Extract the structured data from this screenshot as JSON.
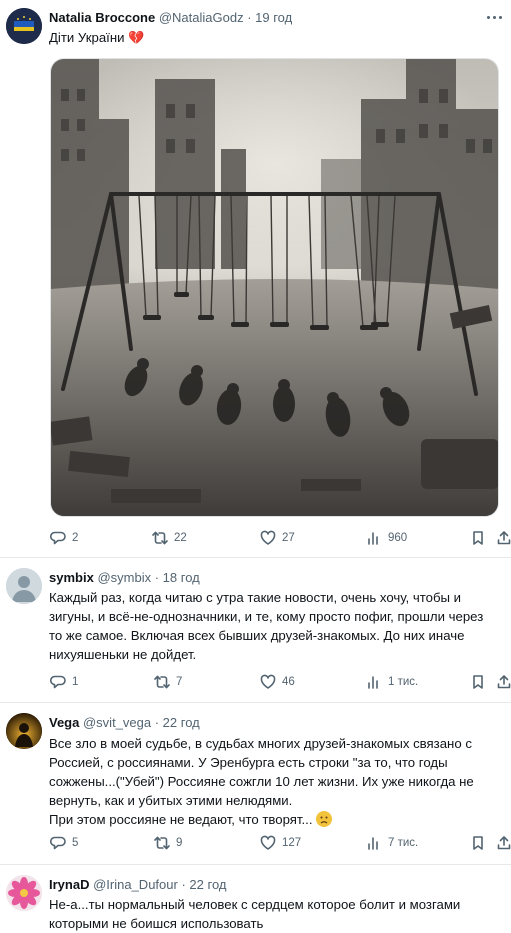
{
  "tweets": [
    {
      "name": "Natalia Broccone",
      "handle": "@NataliaGodz",
      "time": "· 19 год",
      "text_lines": [
        "Діти України"
      ],
      "heart": "💔",
      "stats": {
        "replies": "2",
        "retweets": "22",
        "likes": "27",
        "views": "960"
      }
    },
    {
      "name": "symbix",
      "handle": "@symbix",
      "time": "· 18 год",
      "text_lines": [
        "Каждый раз, когда читаю с утра такие новости, очень хочу, чтобы и",
        "зигуны, и всё-не-однозначники, и те, кому просто пофиг, прошли через",
        "то же самое. Включая всех бывших друзей-знакомых. До них иначе",
        "нихуяшеньки не дойдет."
      ],
      "stats": {
        "replies": "1",
        "retweets": "7",
        "likes": "46",
        "views": "1 тис."
      }
    },
    {
      "name": "Vega",
      "handle": "@svit_vega",
      "time": "· 22 год",
      "text_lines": [
        "Все зло в моей судьбе, в судьбах многих друзей-знакомых связано с",
        "Россией, с россиянами. У Эренбурга есть строки \"за то, что годы",
        "сожжены...(\"Убей\") Россияне сожгли 10 лет жизни. Их уже никогда не",
        "вернуть, как и убитых этими нелюдями.",
        "При этом россияне не ведают, что творят..."
      ],
      "stats": {
        "replies": "5",
        "retweets": "9",
        "likes": "127",
        "views": "7 тис."
      }
    },
    {
      "name": "IrynaD",
      "handle": "@Irina_Dufour",
      "time": "· 22 год",
      "text_lines": [
        "Не-а...ты нормальный человек с сердцем которое болит и мозгами",
        "которыми не боишся использовать"
      ]
    }
  ],
  "icons": {
    "reply": "reply-icon",
    "retweet": "retweet-icon",
    "like": "heart-icon",
    "views": "views-icon",
    "bookmark": "bookmark-icon",
    "share": "share-icon",
    "more": "more-icon"
  },
  "colors": {
    "text": "#0f1419",
    "secondary": "#536471",
    "divider": "#e6e9ec"
  }
}
